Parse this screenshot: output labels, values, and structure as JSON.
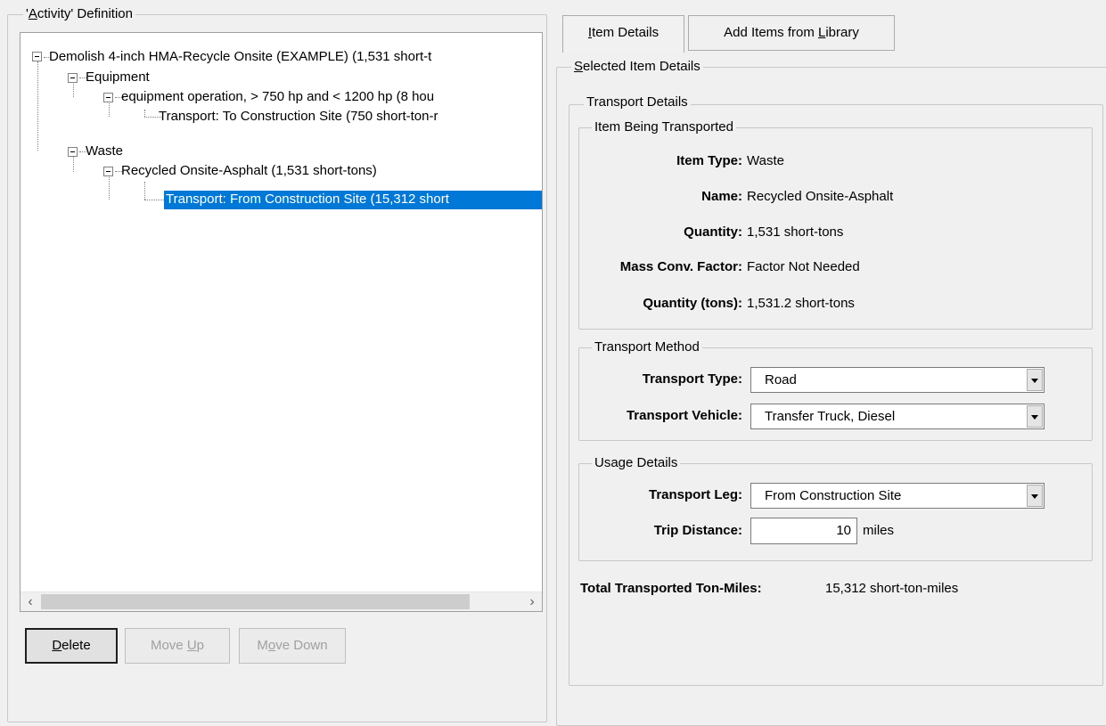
{
  "left_panel": {
    "group_title_prefix": "'",
    "group_title_access": "A",
    "group_title_rest": "ctivity' Definition",
    "tree": [
      {
        "id": "root",
        "label": "Demolish 4-inch HMA-Recycle Onsite (EXAMPLE) (1,531 short-t"
      },
      {
        "id": "equipment",
        "label": "Equipment"
      },
      {
        "id": "equip-op",
        "label": "equipment operation, > 750 hp and < 1200 hp (8 hou"
      },
      {
        "id": "transport-to",
        "label": "Transport: To Construction Site (750 short-ton-r"
      },
      {
        "id": "waste",
        "label": "Waste"
      },
      {
        "id": "recycled",
        "label": "Recycled Onsite-Asphalt (1,531 short-tons)"
      },
      {
        "id": "transport-from",
        "label": "Transport: From Construction Site (15,312 short"
      }
    ],
    "scroll_left": "‹",
    "scroll_right": "›",
    "buttons": {
      "delete_access": "D",
      "delete_rest": "elete",
      "move_up_pre": "Move ",
      "move_up_access": "U",
      "move_up_post": "p",
      "move_down_pre": "M",
      "move_down_access": "o",
      "move_down_post": "ve Down"
    }
  },
  "tabs": {
    "item_details_access": "I",
    "item_details_rest": "tem Details",
    "add_items_pre": "Add Items from ",
    "add_items_access": "L",
    "add_items_post": "ibrary"
  },
  "right_panel": {
    "selected_title_access": "S",
    "selected_title_rest": "elected Item Details",
    "transport_details_title": "Transport Details",
    "item_being_transported": {
      "title": "Item Being Transported",
      "item_type_label": "Item Type:",
      "item_type_value": "Waste",
      "name_label": "Name:",
      "name_value": "Recycled Onsite-Asphalt",
      "quantity_label": "Quantity:",
      "quantity_value": "1,531 short-tons",
      "mass_label": "Mass Conv. Factor:",
      "mass_value": "Factor Not Needed",
      "qty_tons_label": "Quantity (tons):",
      "qty_tons_value": "1,531.2 short-tons"
    },
    "transport_method": {
      "title": "Transport Method",
      "type_label": "Transport Type:",
      "type_value": "Road",
      "vehicle_label": "Transport Vehicle:",
      "vehicle_value": "Transfer Truck, Diesel"
    },
    "usage_details": {
      "title": "Usage Details",
      "leg_label": "Transport Leg:",
      "leg_value": "From Construction Site",
      "distance_label": "Trip Distance:",
      "distance_value": "10",
      "distance_unit": "miles"
    },
    "total_label": "Total Transported Ton-Miles:",
    "total_value": "15,312 short-ton-miles"
  }
}
